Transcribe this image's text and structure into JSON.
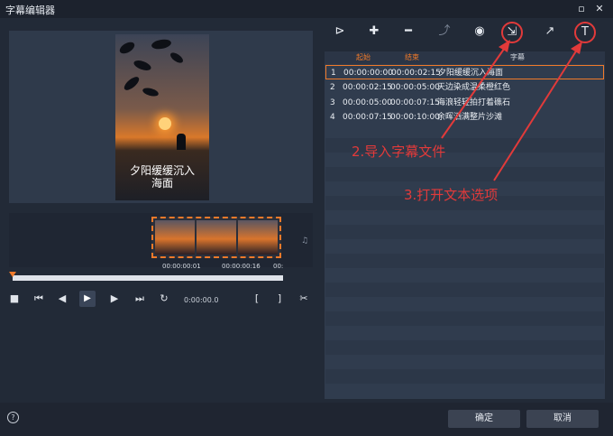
{
  "window": {
    "title": "字幕编辑器",
    "help_glyph": "?",
    "close_glyph": "✕",
    "min_glyph": "▫"
  },
  "preview": {
    "subtitle_line1": "夕阳缓缓沉入",
    "subtitle_line2": "海面"
  },
  "timeline": {
    "timecodes": [
      "00:00:00:01",
      "00:00:00:16",
      "00:"
    ],
    "current_time": "0:00:00.0"
  },
  "toolbar_icons": [
    "play-subtitle-icon",
    "add-icon",
    "remove-icon",
    "merge-icon",
    "preview-eye-icon",
    "import-subtitle-icon",
    "export-icon",
    "text-options-icon"
  ],
  "subtitle_table": {
    "headers": {
      "start": "起始",
      "end": "结束",
      "text": "字幕"
    },
    "rows": [
      {
        "num": "1",
        "start": "00:00:00:00",
        "end": "00:00:02:15",
        "text": "夕阳缓缓沉入海面"
      },
      {
        "num": "2",
        "start": "00:00:02:15",
        "end": "00:00:05:00",
        "text": "天边染成温柔橙红色"
      },
      {
        "num": "3",
        "start": "00:00:05:00",
        "end": "00:00:07:15",
        "text": "海浪轻轻拍打着礁石"
      },
      {
        "num": "4",
        "start": "00:00:07:15",
        "end": "00:00:10:00",
        "text": "余晖洒满整片沙滩"
      }
    ]
  },
  "annotations": {
    "import": "2.导入字幕文件",
    "text_options": "3.打开文本选项"
  },
  "footer": {
    "ok": "确定",
    "cancel": "取消"
  },
  "colors": {
    "accent": "#f07a2a",
    "annotation": "#e23a3a"
  }
}
